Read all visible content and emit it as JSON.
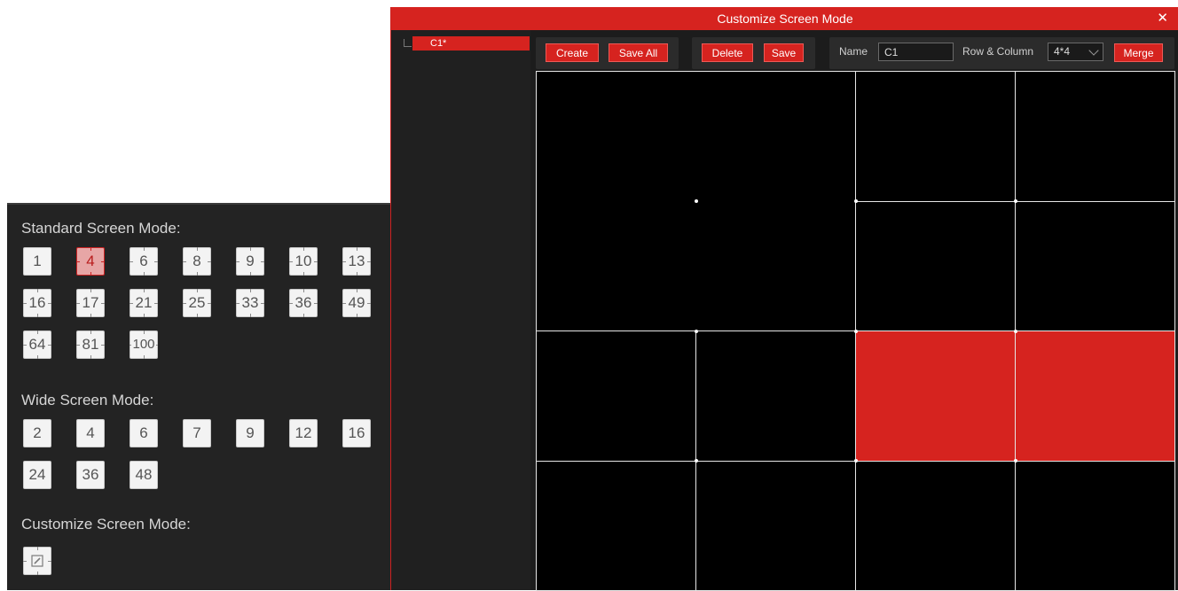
{
  "left_panel": {
    "standard_title": "Standard Screen Mode:",
    "standard_modes": [
      "1",
      "4",
      "6",
      "8",
      "9",
      "10",
      "13",
      "16",
      "17",
      "21",
      "25",
      "33",
      "36",
      "49",
      "64",
      "81",
      "100"
    ],
    "selected_mode": "4",
    "wide_title": "Wide Screen Mode:",
    "wide_modes": [
      "2",
      "4",
      "6",
      "7",
      "9",
      "12",
      "16",
      "24",
      "36",
      "48"
    ],
    "custom_title": "Customize Screen Mode:",
    "custom_icon": "edit-icon"
  },
  "dialog": {
    "title": "Customize Screen Mode",
    "close_symbol": "✕",
    "tree": {
      "item_label": "C1*"
    },
    "toolbar": {
      "create_label": "Create",
      "save_all_label": "Save All",
      "delete_label": "Delete",
      "save_label": "Save",
      "name_label": "Name",
      "name_value": "C1",
      "row_col_label": "Row & Column",
      "row_col_value": "4*4",
      "merge_label": "Merge"
    },
    "grid": {
      "rows": 4,
      "cols": 4,
      "cells": [
        {
          "row": 0,
          "col": 0,
          "rowspan": 2,
          "colspan": 2,
          "selected": false
        },
        {
          "row": 0,
          "col": 2,
          "rowspan": 1,
          "colspan": 1,
          "selected": false
        },
        {
          "row": 0,
          "col": 3,
          "rowspan": 1,
          "colspan": 1,
          "selected": false
        },
        {
          "row": 1,
          "col": 2,
          "rowspan": 1,
          "colspan": 1,
          "selected": false
        },
        {
          "row": 1,
          "col": 3,
          "rowspan": 1,
          "colspan": 1,
          "selected": false
        },
        {
          "row": 2,
          "col": 0,
          "rowspan": 1,
          "colspan": 1,
          "selected": false
        },
        {
          "row": 2,
          "col": 1,
          "rowspan": 1,
          "colspan": 1,
          "selected": false
        },
        {
          "row": 2,
          "col": 2,
          "rowspan": 1,
          "colspan": 1,
          "selected": true
        },
        {
          "row": 2,
          "col": 3,
          "rowspan": 1,
          "colspan": 1,
          "selected": true
        },
        {
          "row": 3,
          "col": 0,
          "rowspan": 1,
          "colspan": 1,
          "selected": false
        },
        {
          "row": 3,
          "col": 1,
          "rowspan": 1,
          "colspan": 1,
          "selected": false
        },
        {
          "row": 3,
          "col": 2,
          "rowspan": 1,
          "colspan": 1,
          "selected": false
        },
        {
          "row": 3,
          "col": 3,
          "rowspan": 1,
          "colspan": 1,
          "selected": false
        }
      ]
    }
  },
  "colors": {
    "accent": "#d6231f",
    "panel_bg": "#232323",
    "grid_bg": "#000000",
    "grid_line": "#e6e6e6"
  }
}
